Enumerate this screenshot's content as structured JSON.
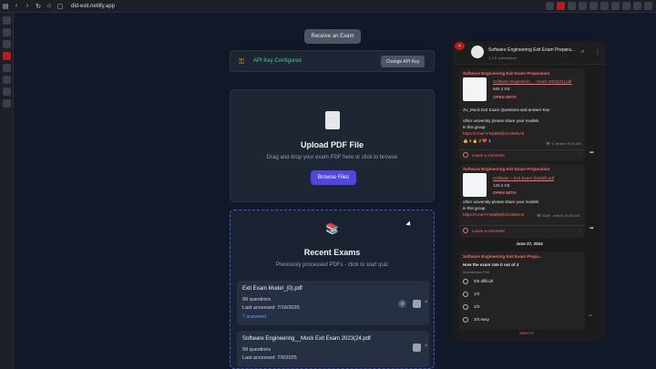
{
  "browser": {
    "url": "did-exit.netlify.app"
  },
  "page": {
    "receive_button": "Receive an Exam",
    "api": {
      "status": "API Key Configured",
      "change_button": "Change API Key"
    },
    "upload": {
      "title": "Upload PDF File",
      "subtitle": "Drag and drop your exam PDF here or click to browse",
      "browse_button": "Browse Files"
    },
    "recent": {
      "title": "Recent Exams",
      "subtitle": "Previously processed PDFs - click to start quiz",
      "exams": [
        {
          "name": "Exit Exam Model_(0).pdf",
          "questions": "99 questions",
          "accessed": "Last accessed: 7/16/2025",
          "answered": "7 answered"
        },
        {
          "name": "Software Engineering__Mock Exit Exam 2023(24.pdf",
          "questions": "99 questions",
          "accessed": "Last accessed: 7/9/2025",
          "answered": ""
        }
      ]
    }
  },
  "telegram": {
    "channel_title": "Software Engineering Exit Exam Prepara...",
    "subscribers": "1.2 K subscribers",
    "msg1": {
      "channel": "Software Engineering Exit Exam Preparation",
      "file_name": "Software Engineerin... - Exam 2023(24).pdf",
      "file_size": "689.3 KB",
      "open_with": "OPEN WITH",
      "line1": "JU_Mock Exit Exam Questions and answer Key",
      "line2": "other university please share your models",
      "line3": "in this group",
      "link": "https://t.me/+FMj4BWjhzU3MDAII",
      "reactions": "👍 3   🔥 2   ❤️ 1",
      "views": "👁 474",
      "edited": "edited 9:50 AM",
      "comment": "Leave a comment"
    },
    "msg2": {
      "channel": "Software Engineering Exit Exam Preparation",
      "file_name": "Software ~ Exit Exam (Model).pdf",
      "file_size": "126.3 KB",
      "open_with": "OPEN WITH",
      "line2": "other university please share your models",
      "line3": "in this group",
      "link": "https://t.me/+FMj4BWjhzU3MDAII",
      "views": "👁 4689",
      "edited": "edited 10:25 AM",
      "comment": "Leave a comment"
    },
    "date_separator": "June 27, 2024",
    "poll": {
      "channel": "Software Engineering Exit Exam Prepa...",
      "question": "How the exam rate it out of 4",
      "type": "Anonymous Poll",
      "options": [
        "0/5 difficult",
        "1/3",
        "2/3",
        "3/3 easy"
      ],
      "footer": "2860775"
    }
  },
  "colors": {
    "accent": "#4f46e5",
    "api_ok": "#34d399",
    "telegram_red": "#ff6b6b"
  }
}
